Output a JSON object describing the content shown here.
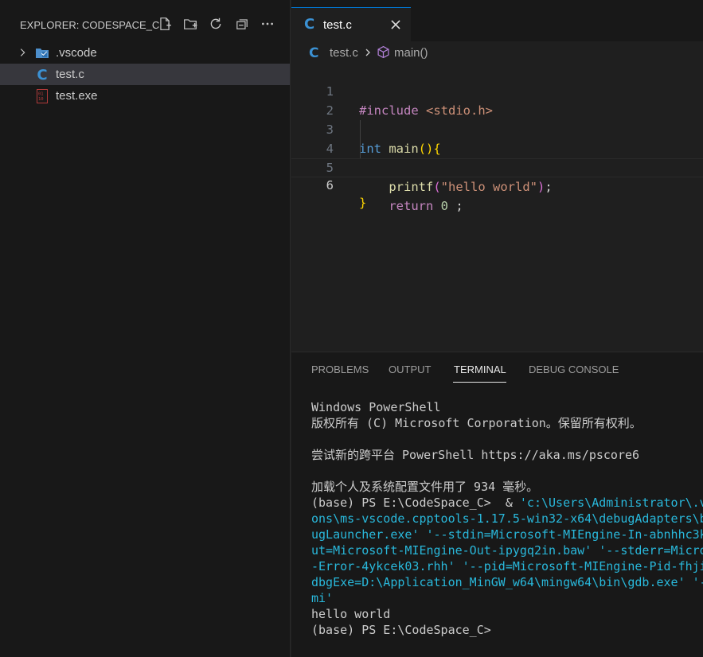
{
  "explorer": {
    "title": "EXPLORER: CODESPACE_C",
    "actions": [
      "new-file-icon",
      "new-folder-icon",
      "refresh-icon",
      "collapse-all-icon",
      "more-icon"
    ],
    "items": [
      {
        "label": ".vscode",
        "type": "folder",
        "icon": "vscode-folder-icon"
      },
      {
        "label": "test.c",
        "type": "file",
        "icon": "c-file-icon",
        "selected": true
      },
      {
        "label": "test.exe",
        "type": "file",
        "icon": "binary-file-icon"
      }
    ]
  },
  "editor": {
    "tab": {
      "label": "test.c",
      "logo": "C"
    },
    "breadcrumb": {
      "logo": "C",
      "file": "test.c",
      "symbol": "main()"
    },
    "lines": [
      {
        "n": "1",
        "text": "#include <stdio.h>"
      },
      {
        "n": "2",
        "text": ""
      },
      {
        "n": "3",
        "text": "int main(){"
      },
      {
        "n": "4",
        "text": "    printf(\"hello world\");"
      },
      {
        "n": "5",
        "text": "    return 0 ;"
      },
      {
        "n": "6",
        "text": "}"
      }
    ],
    "active_line": "6"
  },
  "panel": {
    "tabs": [
      "PROBLEMS",
      "OUTPUT",
      "TERMINAL",
      "DEBUG CONSOLE"
    ],
    "active_tab": "TERMINAL",
    "terminal": {
      "l1": "Windows PowerShell",
      "l2": "版权所有 (C) Microsoft Corporation。保留所有权利。",
      "l3": "尝试新的跨平台 PowerShell https://aka.ms/pscore6",
      "l4": "加载个人及系统配置文件用了 934 毫秒。",
      "l5_prompt": "(base) PS E:\\CodeSpace_C>  & ",
      "l5_cmd": "'c:\\Users\\Administrator\\.v",
      "l6": "ons\\ms-vscode.cpptools-1.17.5-win32-x64\\debugAdapters\\b",
      "l7": "ugLauncher.exe' '--stdin=Microsoft-MIEngine-In-abnhhc3k",
      "l8": "ut=Microsoft-MIEngine-Out-ipygq2in.baw' '--stderr=Micro",
      "l9": "-Error-4ykcek03.rhh' '--pid=Microsoft-MIEngine-Pid-fhji",
      "l10": "dbgExe=D:\\Application_MinGW_w64\\mingw64\\bin\\gdb.exe' '-",
      "l11": "mi'",
      "l12": "hello world",
      "l13": "(base) PS E:\\CodeSpace_C>"
    }
  },
  "colors": {
    "accent": "#0078d4",
    "c_logo": "#3b91d3",
    "terminal_cyan": "#29b8db"
  }
}
